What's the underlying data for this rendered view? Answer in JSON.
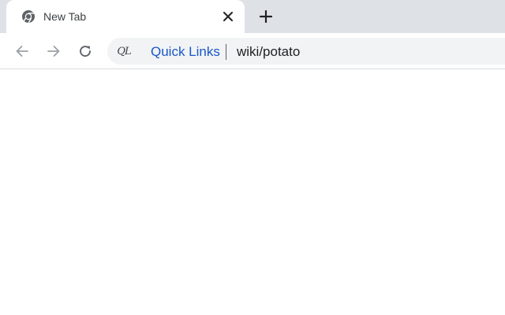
{
  "tab": {
    "title": "New Tab",
    "favicon": "chrome-logo-icon",
    "close_icon": "close-icon"
  },
  "tabstrip": {
    "new_tab_icon": "plus-icon"
  },
  "toolbar": {
    "back_icon": "arrow-left-icon",
    "forward_icon": "arrow-right-icon",
    "reload_icon": "reload-icon"
  },
  "omnibox": {
    "chip_text": "QL",
    "site_name": "Quick Links",
    "path": "wiki/potato"
  },
  "colors": {
    "tabstrip_bg": "#dee1e6",
    "omnibox_bg": "#f1f3f4",
    "link_blue": "#1a57c8",
    "icon_gray": "#5f6368",
    "disabled_gray": "#9aa0a6"
  }
}
